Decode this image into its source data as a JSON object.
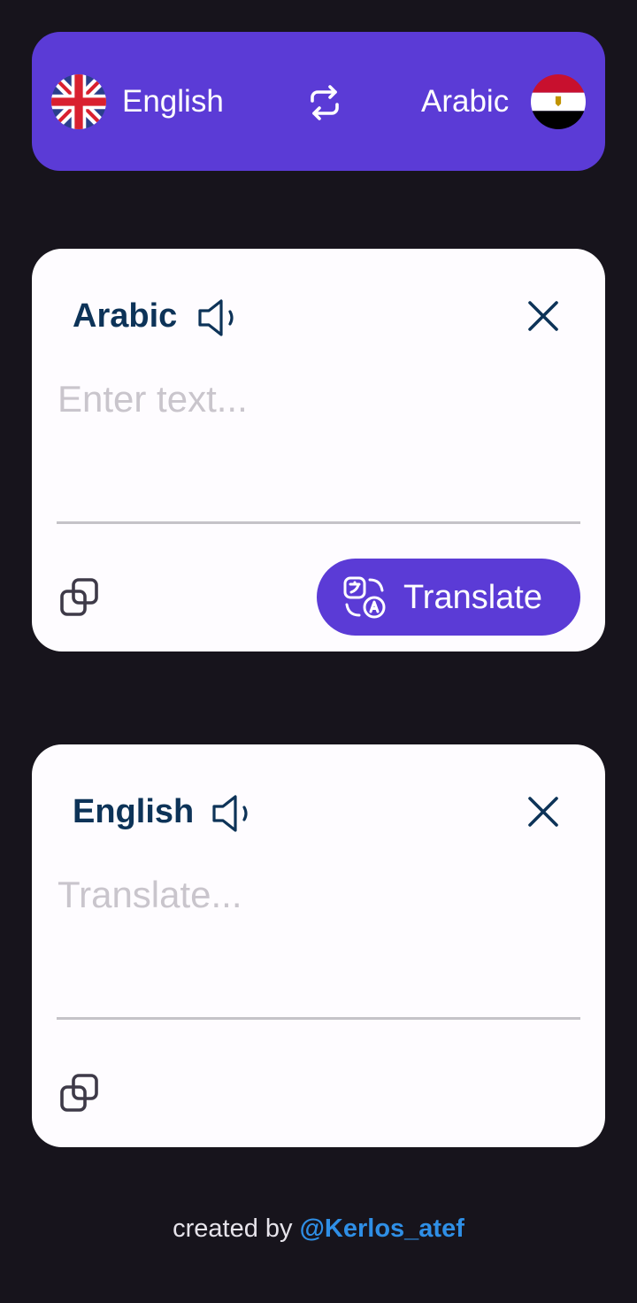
{
  "language_bar": {
    "source_language": "English",
    "target_language": "Arabic",
    "source_flag": "uk-flag-icon",
    "target_flag": "egypt-flag-icon",
    "swap_icon": "swap-icon"
  },
  "input_card": {
    "language_label": "Arabic",
    "placeholder": "Enter text...",
    "value": "",
    "translate_button_label": "Translate"
  },
  "output_card": {
    "language_label": "English",
    "placeholder": "Translate...",
    "value": ""
  },
  "footer": {
    "prefix": "created by",
    "handle": "@Kerlos_atef"
  },
  "colors": {
    "background": "#17141c",
    "accent": "#5b3bd6",
    "card": "#fefcff",
    "title_text": "#0d3358",
    "placeholder": "#c9c5cc",
    "link": "#2f8fe6"
  }
}
